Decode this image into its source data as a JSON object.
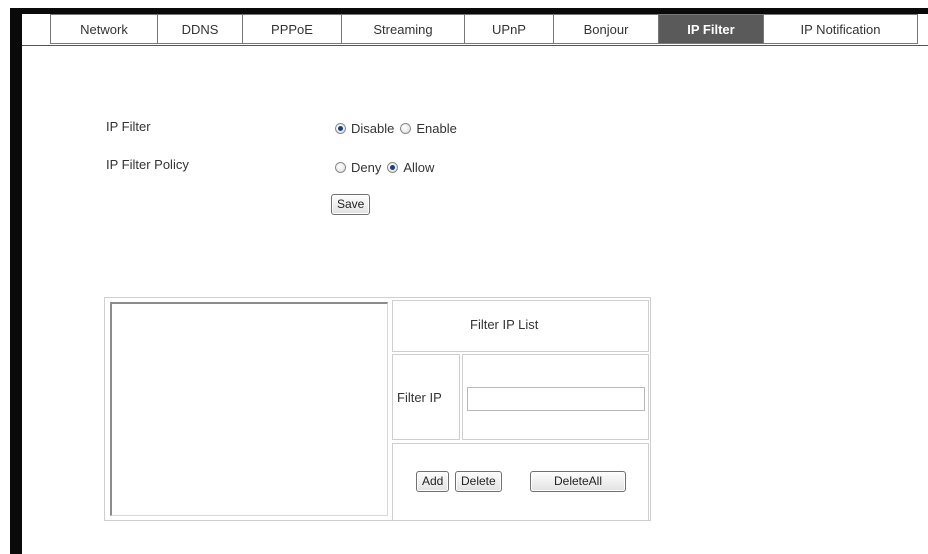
{
  "tabs": [
    {
      "label": "Network",
      "active": false
    },
    {
      "label": "DDNS",
      "active": false
    },
    {
      "label": "PPPoE",
      "active": false
    },
    {
      "label": "Streaming",
      "active": false
    },
    {
      "label": "UPnP",
      "active": false
    },
    {
      "label": "Bonjour",
      "active": false
    },
    {
      "label": "IP Filter",
      "active": true
    },
    {
      "label": "IP Notification",
      "active": false
    }
  ],
  "form": {
    "ip_filter_label": "IP Filter",
    "ip_filter_options": {
      "disable": "Disable",
      "enable": "Enable",
      "selected": "Disable"
    },
    "policy_label": "IP Filter Policy",
    "policy_options": {
      "deny": "Deny",
      "allow": "Allow",
      "selected": "Allow"
    },
    "save_label": "Save"
  },
  "filter_list": {
    "title": "Filter IP List",
    "filter_ip_label": "Filter IP",
    "filter_ip_value": "",
    "entries": [],
    "add_label": "Add",
    "delete_label": "Delete",
    "delete_all_label": "DeleteAll"
  },
  "colors": {
    "active_tab_bg": "#5a5a5a",
    "frame": "#0a0a0a",
    "radio_dot": "#1d3f7a"
  }
}
